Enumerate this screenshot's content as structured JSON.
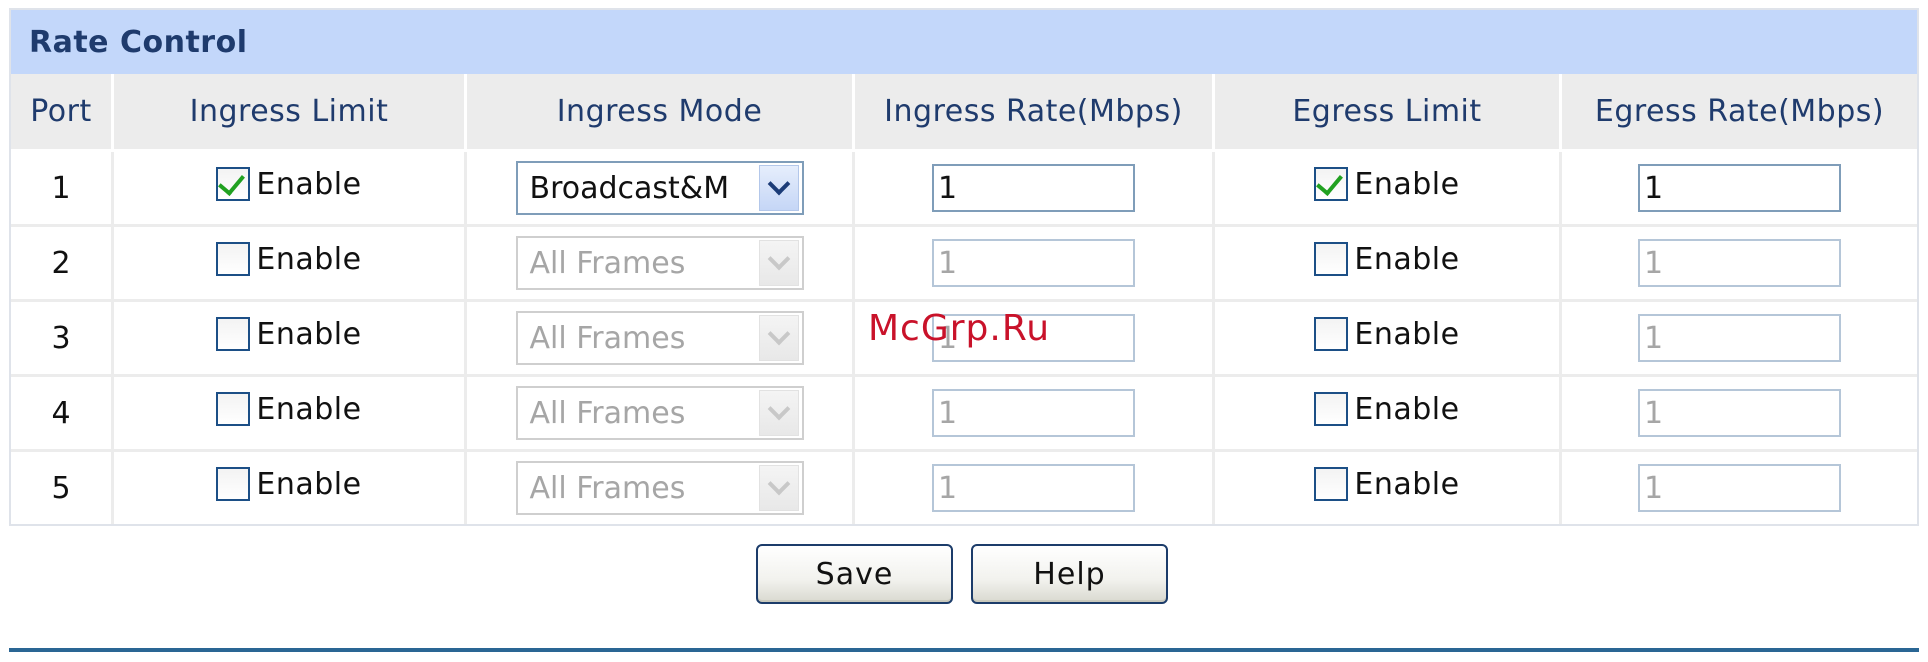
{
  "panel": {
    "title": "Rate Control"
  },
  "columns": [
    "Port",
    "Ingress Limit",
    "Ingress Mode",
    "Ingress Rate(Mbps)",
    "Egress Limit",
    "Egress Rate(Mbps)"
  ],
  "enable_label": "Enable",
  "rows": [
    {
      "port": "1",
      "ingress_enabled": true,
      "ingress_mode": "Broadcast&M",
      "ingress_rate": "1",
      "egress_enabled": true,
      "egress_rate": "1"
    },
    {
      "port": "2",
      "ingress_enabled": false,
      "ingress_mode": "All Frames",
      "ingress_rate": "1",
      "egress_enabled": false,
      "egress_rate": "1"
    },
    {
      "port": "3",
      "ingress_enabled": false,
      "ingress_mode": "All Frames",
      "ingress_rate": "1",
      "egress_enabled": false,
      "egress_rate": "1"
    },
    {
      "port": "4",
      "ingress_enabled": false,
      "ingress_mode": "All Frames",
      "ingress_rate": "1",
      "egress_enabled": false,
      "egress_rate": "1"
    },
    {
      "port": "5",
      "ingress_enabled": false,
      "ingress_mode": "All Frames",
      "ingress_rate": "1",
      "egress_enabled": false,
      "egress_rate": "1"
    }
  ],
  "buttons": {
    "save": "Save",
    "help": "Help"
  },
  "watermark": "McGrp.Ru",
  "icons": {
    "checkbox_checked": "check-icon",
    "dropdown": "chevron-down-icon"
  },
  "colors": {
    "title_bg": "#c3d7fa",
    "header_text": "#1f3b6d",
    "accent_line": "#2a6694",
    "check": "#21a121"
  }
}
